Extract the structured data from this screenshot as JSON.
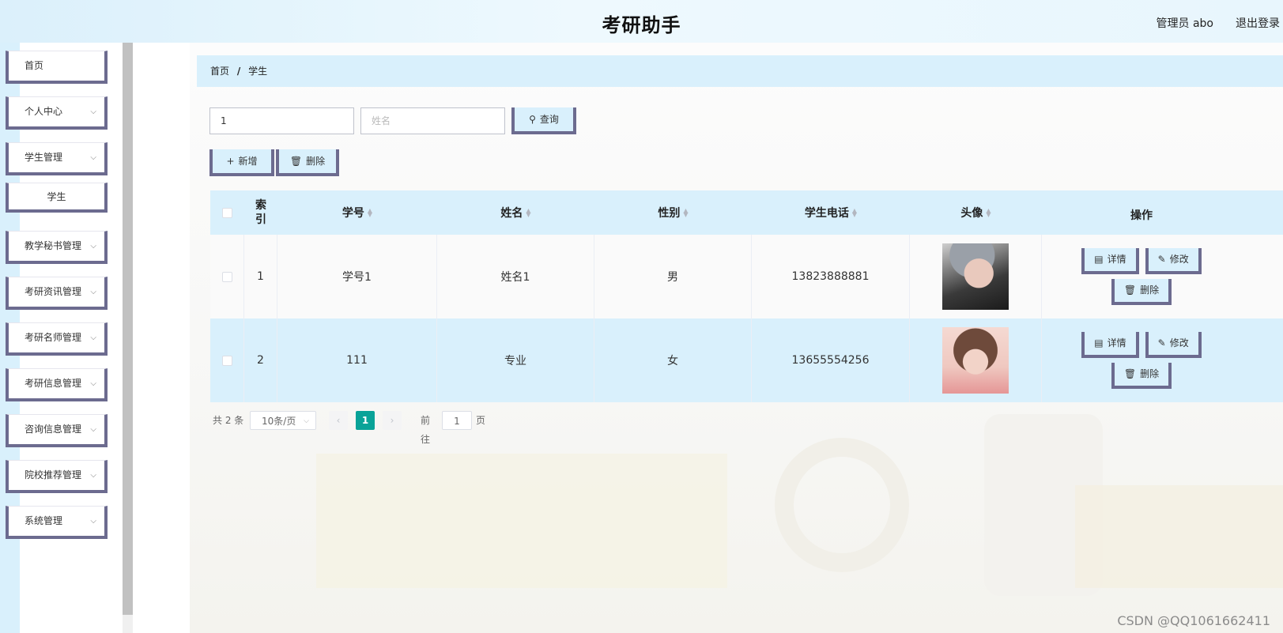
{
  "header": {
    "title": "考研助手",
    "admin": "管理员 abo",
    "logout": "退出登录"
  },
  "sidebar": {
    "items": [
      {
        "label": "首页",
        "has_children": false
      },
      {
        "label": "个人中心",
        "has_children": true
      },
      {
        "label": "学生管理",
        "has_children": true
      },
      {
        "label": "学生",
        "has_children": false,
        "submenu": true
      },
      {
        "label": "教学秘书管理",
        "has_children": true
      },
      {
        "label": "考研资讯管理",
        "has_children": true
      },
      {
        "label": "考研名师管理",
        "has_children": true
      },
      {
        "label": "考研信息管理",
        "has_children": true
      },
      {
        "label": "咨询信息管理",
        "has_children": true
      },
      {
        "label": "院校推荐管理",
        "has_children": true
      },
      {
        "label": "系统管理",
        "has_children": true
      }
    ]
  },
  "breadcrumb": {
    "home": "首页",
    "sep": "/",
    "current": "学生"
  },
  "search": {
    "student_no_value": "1",
    "name_placeholder": "姓名",
    "query_label": "查询"
  },
  "toolbar": {
    "add_label": "新增",
    "delete_label": "删除"
  },
  "table": {
    "headers": {
      "index": "索引",
      "student_no": "学号",
      "name": "姓名",
      "gender": "性别",
      "phone": "学生电话",
      "avatar": "头像",
      "actions": "操作"
    },
    "rows": [
      {
        "index": "1",
        "student_no": "学号1",
        "name": "姓名1",
        "gender": "男",
        "phone": "13823888881"
      },
      {
        "index": "2",
        "student_no": "111",
        "name": "专业",
        "gender": "女",
        "phone": "13655554256"
      }
    ],
    "row_actions": {
      "detail": "详情",
      "edit": "修改",
      "delete": "删除"
    }
  },
  "pagination": {
    "total": "共 2 条",
    "page_size": "10条/页",
    "current_page": "1",
    "goto_prefix": "前往",
    "goto_value": "1",
    "goto_suffix": "页"
  },
  "watermark": "CSDN @QQ1061662411",
  "colors": {
    "accent_bg": "#d9f0fc",
    "border_accent": "#6c6b8f",
    "pager_active": "#09a398"
  },
  "icons": {
    "search": "search-icon",
    "add": "plus-icon",
    "delete": "trash-icon",
    "detail": "document-icon",
    "edit": "pencil-icon",
    "chevron": "chevron-down-icon"
  }
}
